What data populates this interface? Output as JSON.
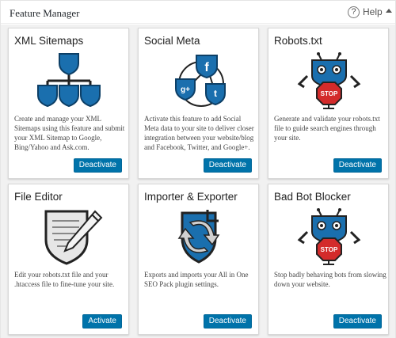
{
  "header": {
    "title": "Feature Manager",
    "help_label": "Help",
    "help_icon": "?"
  },
  "colors": {
    "button_bg": "#0073aa",
    "icon_blue": "#1a6fae",
    "robot_red": "#d32b2b"
  },
  "cards": [
    {
      "title": "XML Sitemaps",
      "icon": "sitemap-icon",
      "description": "Create and manage your XML Sitemaps using this feature and submit your XML Sitemap to Google, Bing/Yahoo and Ask.com.",
      "button": "Deactivate"
    },
    {
      "title": "Social Meta",
      "icon": "social-icon",
      "description": "Activate this feature to add Social Meta data to your site to deliver closer integration between your website/blog and Facebook, Twitter, and Google+.",
      "button": "Deactivate"
    },
    {
      "title": "Robots.txt",
      "icon": "robot-icon",
      "description": "Generate and validate your robots.txt file to guide search engines through your site.",
      "button": "Deactivate",
      "robot_sign": "STOP"
    },
    {
      "title": "File Editor",
      "icon": "file-editor-icon",
      "description": "Edit your robots.txt file and your .htaccess file to fine-tune your site.",
      "button": "Activate"
    },
    {
      "title": "Importer & Exporter",
      "icon": "import-export-icon",
      "description": "Exports and imports your All in One SEO Pack plugin settings.",
      "button": "Deactivate"
    },
    {
      "title": "Bad Bot Blocker",
      "icon": "bad-bot-icon",
      "description": "Stop badly behaving bots from slowing down your website.",
      "button": "Deactivate",
      "robot_sign": "STOP"
    }
  ]
}
